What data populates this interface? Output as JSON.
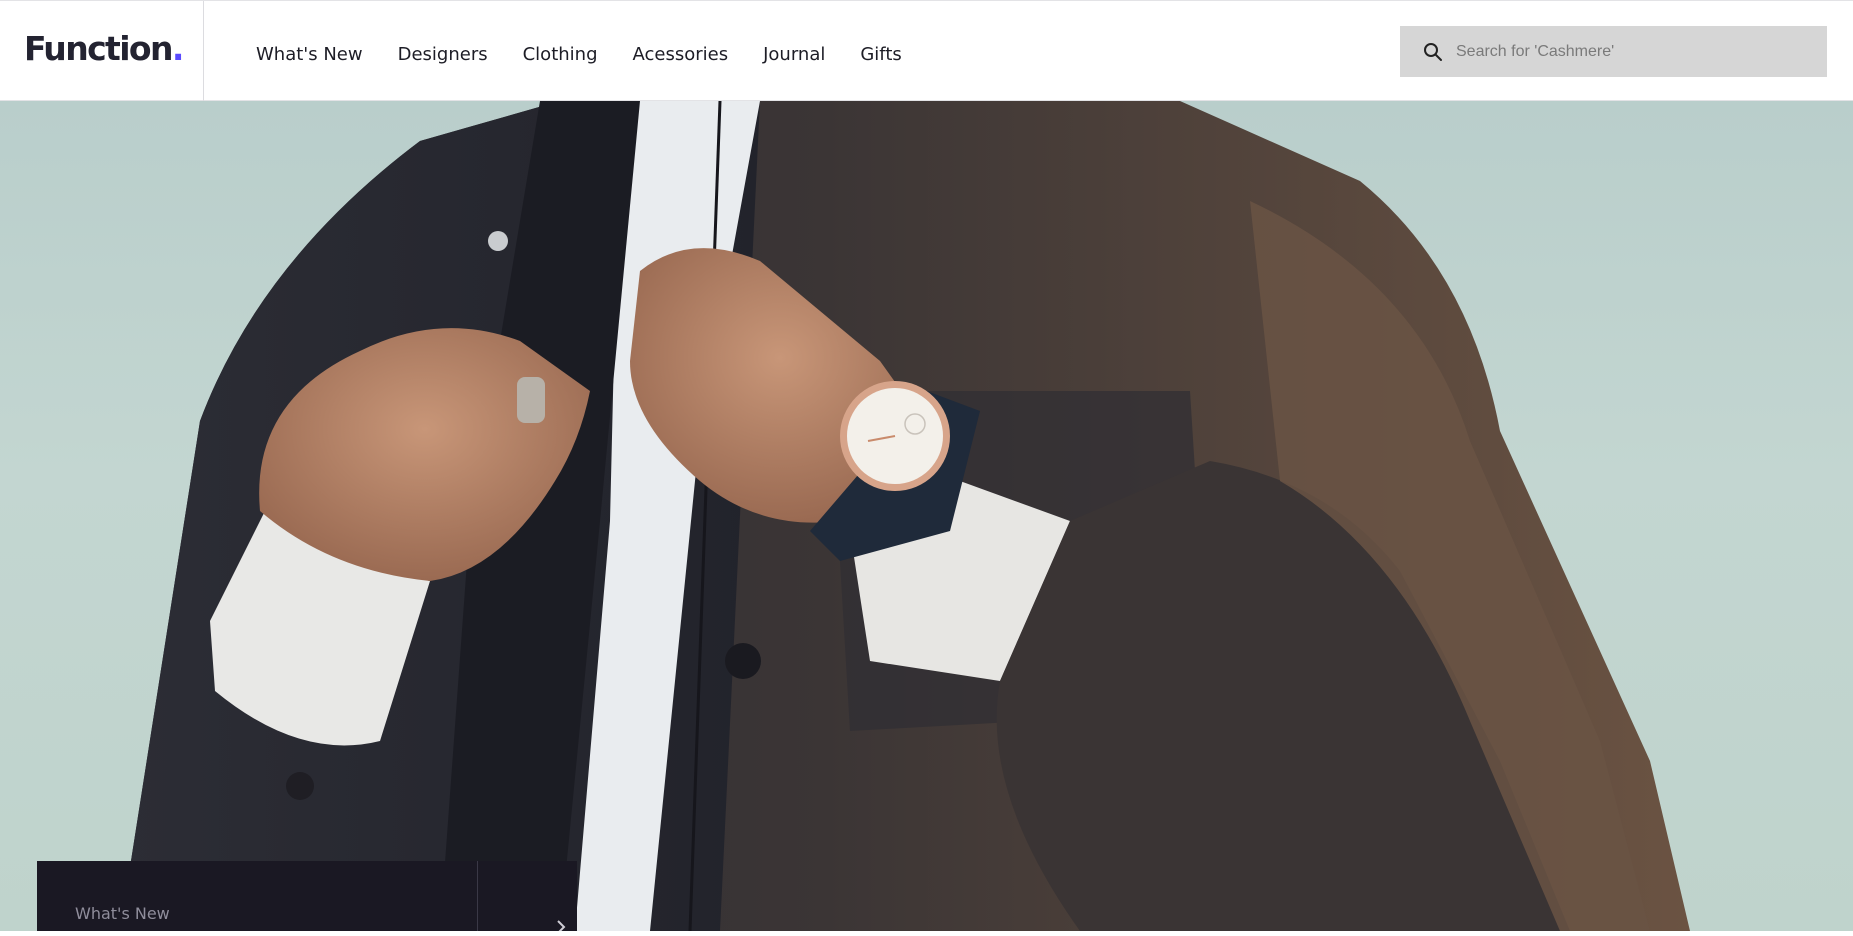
{
  "brand": {
    "name": "Function",
    "dot": ".",
    "accent_color": "#5a4bff"
  },
  "nav": {
    "items": [
      {
        "label": "What's New"
      },
      {
        "label": "Designers"
      },
      {
        "label": "Clothing"
      },
      {
        "label": "Acessories"
      },
      {
        "label": "Journal"
      },
      {
        "label": "Gifts"
      }
    ]
  },
  "search": {
    "placeholder": "Search for 'Cashmere'",
    "value": "",
    "icon": "search-icon"
  },
  "hero": {
    "image": "man-in-jacket-wearing-watch-photo"
  },
  "promo": {
    "label": "What's New",
    "arrow_icon": "chevron-right-icon",
    "background": "#1a1823"
  }
}
